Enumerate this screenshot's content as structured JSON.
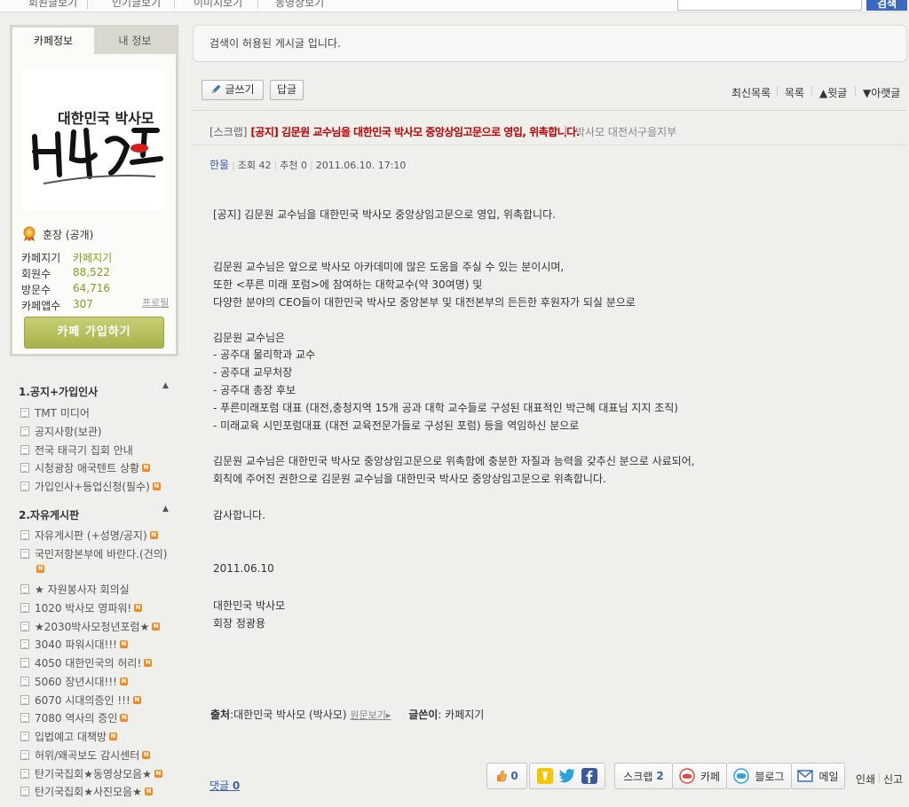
{
  "topnav": {
    "items": [
      "회원글보기",
      "인기글보기",
      "이미지보기",
      "동영상보기"
    ],
    "search_button": "검색"
  },
  "sidebar": {
    "tabs": [
      "카페정보",
      "내 정보"
    ],
    "logo_text": "대한민국 박사모",
    "grade": "훈장 (공개)",
    "stats": [
      {
        "label": "카페지기",
        "value": "카페지기"
      },
      {
        "label": "회원수",
        "value": "88,522"
      },
      {
        "label": "방문수",
        "value": "64,716"
      },
      {
        "label": "카페앱수",
        "value": "307"
      }
    ],
    "profile_link": "프로필",
    "join_button": "카페 가입하기",
    "menus": [
      {
        "title": "1.공지+가입인사",
        "items": [
          {
            "label": "TMT 미디어",
            "new": false
          },
          {
            "label": "공지사항(보관)",
            "new": false
          },
          {
            "label": "전국 태극기 집회 안내",
            "new": false
          },
          {
            "label": "시청광장 애국텐트 상황",
            "new": true
          },
          {
            "label": "가입인사+등업신청(필수)",
            "new": true
          }
        ]
      },
      {
        "title": "2.자유게시판",
        "items": [
          {
            "label": "자유게시판 (+성명/공지)",
            "new": true
          },
          {
            "label": "국민저항본부에 바란다.(건의)",
            "new": true
          },
          {
            "label": "★ 자원봉사자 회의실",
            "new": false
          },
          {
            "label": "1020 박사모 영파워!",
            "new": true
          },
          {
            "label": "★2030박사모청년포럼★",
            "new": true
          },
          {
            "label": "3040 파워시대!!!",
            "new": true
          },
          {
            "label": "4050 대한민국의 허리!",
            "new": true
          },
          {
            "label": "5060 장년시대!!!",
            "new": true
          },
          {
            "label": "6070 시대의증인 !!!",
            "new": true
          },
          {
            "label": "7080 역사의 증인",
            "new": true
          },
          {
            "label": "입법예고 대책방",
            "new": true
          },
          {
            "label": "허위/왜곡보도 감시센터",
            "new": true
          },
          {
            "label": "탄기국집회★동영상모음★",
            "new": true
          },
          {
            "label": "탄기국집회★사진모음★",
            "new": true
          }
        ]
      }
    ]
  },
  "notice": "검색이 허용된 게시글 입니다.",
  "toolbar": {
    "write": "글쓰기",
    "reply": "답글",
    "links": [
      "최신목록",
      "목록",
      "▲윗글",
      "▼아랫글"
    ]
  },
  "post": {
    "scrap_tag": "[스크랩]",
    "title": "[공지] 김문원 교수님을 대한민국 박사모 중앙상임고문으로 영입, 위촉합니다.",
    "cafe_name": "박사모 대전서구을지부",
    "author": "한울",
    "views": "조회 42",
    "recommend": "추천 0",
    "date": "2011.06.10. 17:10",
    "body": [
      "[공지] 김문원 교수님을 대한민국 박사모 중앙상임고문으로 영입, 위촉합니다.",
      "김문원 교수님은 앞으로 박사모 아카데미에 많은 도움을 주실 수 있는 분이시며,",
      "또한 <푸른 미래 포럼>에 참여하는 대학교수(약 30여명) 및",
      "다양한 분야의 CEO들이 대한민국 박사모 중앙본부 및 대전본부의 든든한 후원자가 되실 분으로",
      "김문원 교수님은",
      "- 공주대 물리학과 교수",
      "- 공주대 교무처장",
      "- 공주대 총장 후보",
      "- 푸른미래포럼 대표 (대전,충청지역 15개 공과 대학 교수들로 구성된 대표적인 박근혜 대표님 지지 조직)",
      "- 미래교육 시민포럼대표 (대전 교육전문가들로 구성된 포럼) 등을 역임하신 분으로",
      "김문원 교수님은 대한민국 박사모 중앙상임고문으로 위촉함에 충분한 자질과 능력을 갖추신 분으로 사료되어,",
      "회칙에 주어진 권한으로 김문원 교수님을 대한민국 박사모 중앙상임고문으로 위촉합니다.",
      "감사합니다.",
      "2011.06.10",
      "대한민국 박사모",
      "회장 정광용"
    ],
    "source_label": "출처",
    "source": ":대한민국 박사모 (박사모)",
    "view_original": "원문보기▸",
    "writer_label": "글쓴이",
    "writer": ": 카페지기",
    "comments_label": "댓글",
    "comments_count": "0"
  },
  "share": {
    "like_count": "0",
    "scrap_label": "스크랩",
    "scrap_count": "2",
    "cafe": "카페",
    "blog": "블로그",
    "mail": "메일",
    "print": "인쇄",
    "report": "신고"
  }
}
